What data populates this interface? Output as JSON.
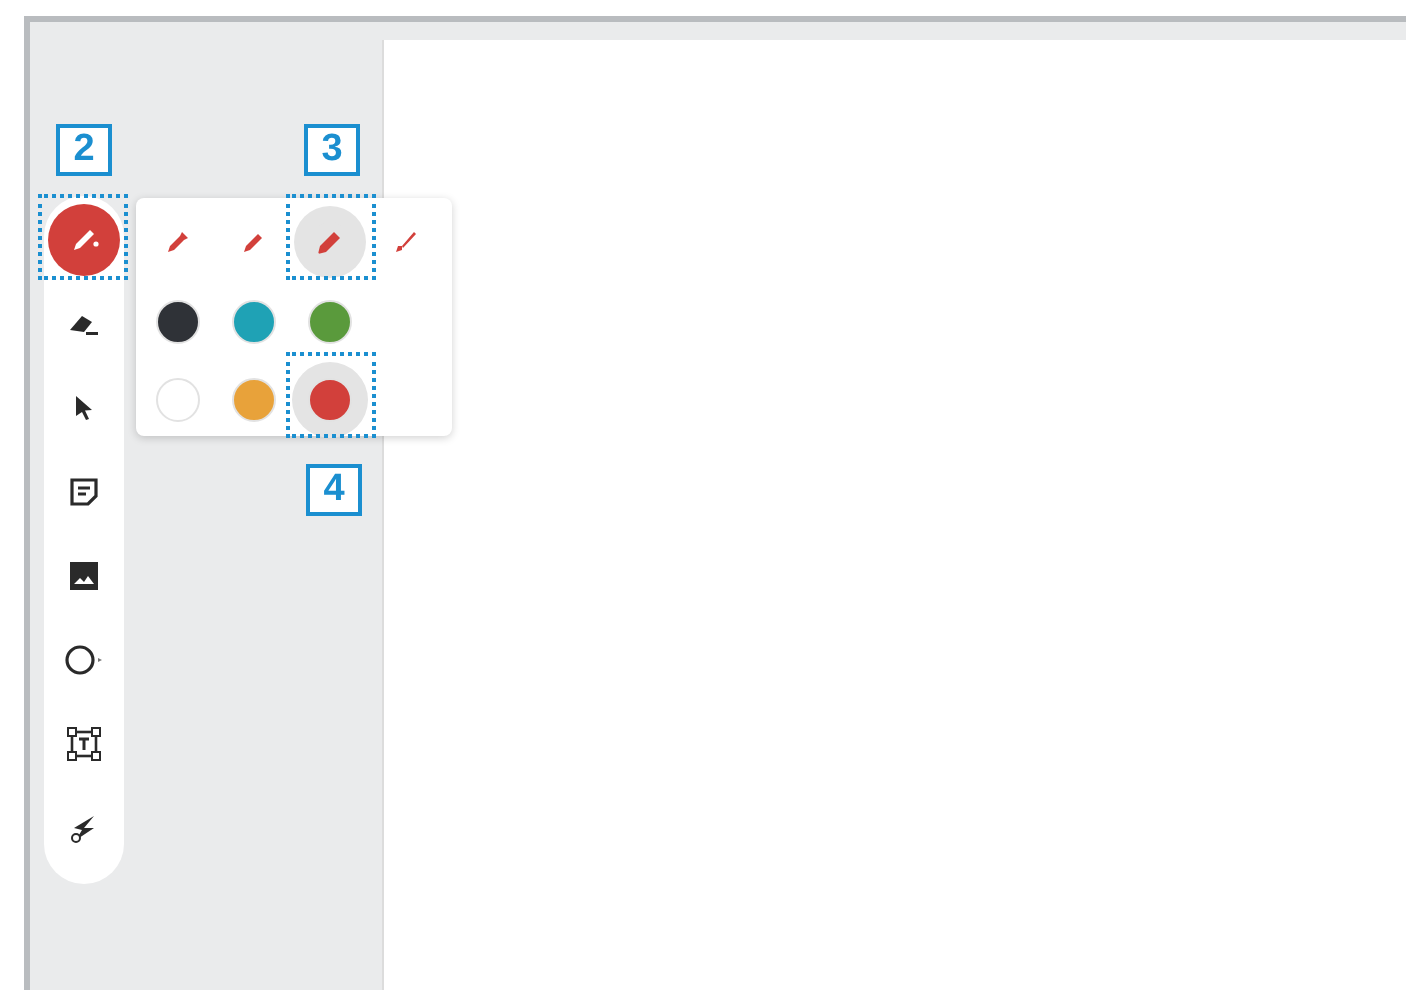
{
  "tools": [
    {
      "kind": "pen",
      "selected": true
    },
    {
      "kind": "eraser",
      "selected": false
    },
    {
      "kind": "select",
      "selected": false
    },
    {
      "kind": "note",
      "selected": false
    },
    {
      "kind": "image",
      "selected": false
    },
    {
      "kind": "shape",
      "selected": false
    },
    {
      "kind": "textbox",
      "selected": false
    },
    {
      "kind": "laser",
      "selected": false
    }
  ],
  "pen_options": [
    {
      "kind": "marker",
      "selected": false
    },
    {
      "kind": "pen",
      "selected": false
    },
    {
      "kind": "highlighter",
      "selected": true
    },
    {
      "kind": "brush",
      "selected": false
    }
  ],
  "colors": [
    {
      "color": "#2f3237",
      "selected": false
    },
    {
      "color": "#1fa2b5",
      "selected": false
    },
    {
      "color": "#5a9a3c",
      "selected": false
    },
    {
      "color": "#ffffff",
      "selected": false
    },
    {
      "color": "#e8a23a",
      "selected": false
    },
    {
      "color": "#d2403b",
      "selected": true
    }
  ],
  "callouts": [
    {
      "label": "2"
    },
    {
      "label": "3"
    },
    {
      "label": "4"
    }
  ]
}
